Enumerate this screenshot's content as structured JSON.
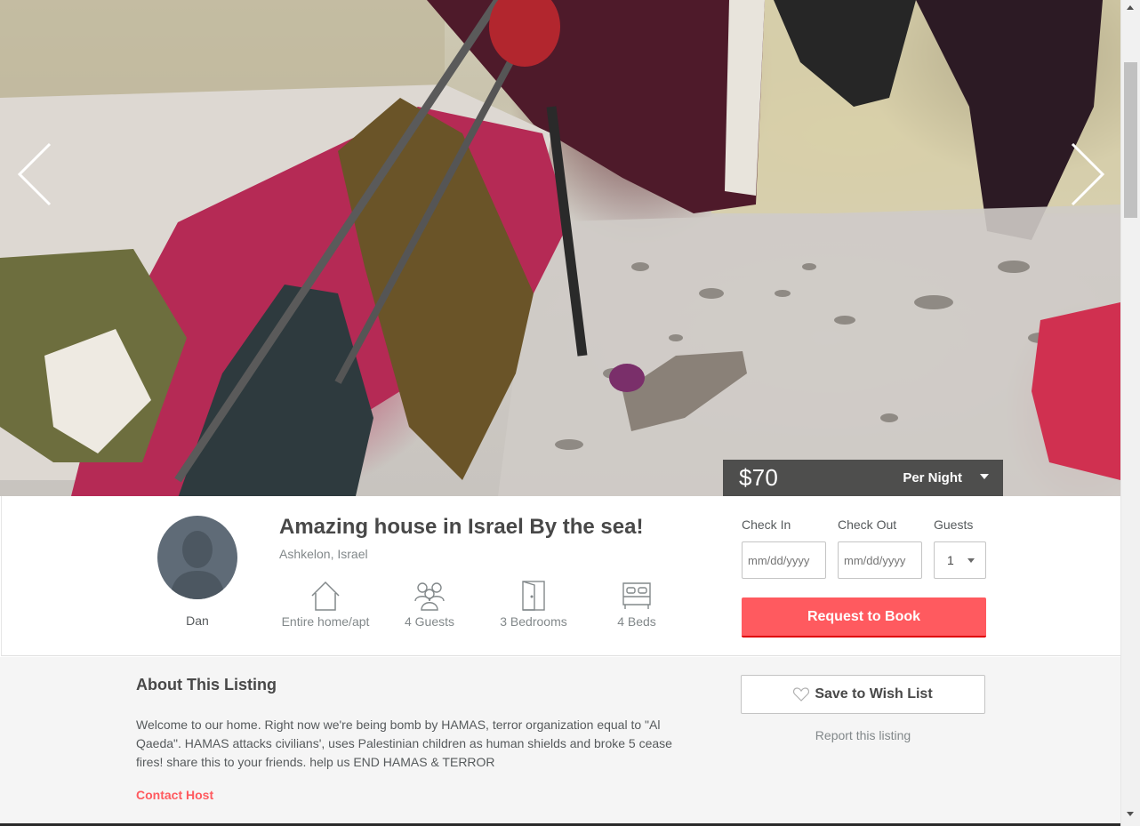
{
  "gallery": {
    "prev_label": "Previous photo",
    "next_label": "Next photo"
  },
  "price": {
    "amount": "$70",
    "period": "Per Night"
  },
  "host": {
    "name": "Dan"
  },
  "listing": {
    "title": "Amazing house in Israel By the sea!",
    "location": "Ashkelon, Israel",
    "amenities": [
      {
        "icon": "house-icon",
        "label": "Entire home/apt"
      },
      {
        "icon": "guests-icon",
        "label": "4 Guests"
      },
      {
        "icon": "door-icon",
        "label": "3 Bedrooms"
      },
      {
        "icon": "bed-icon",
        "label": "4 Beds"
      }
    ]
  },
  "booking": {
    "check_in_label": "Check In",
    "check_out_label": "Check Out",
    "guests_label": "Guests",
    "date_placeholder": "mm/dd/yyyy",
    "guests_value": "1",
    "request_button": "Request to Book"
  },
  "about": {
    "heading": "About This Listing",
    "description": "Welcome to our home. Right now we're being bomb by HAMAS, terror organization equal to \"Al Qaeda\". HAMAS attacks civilians', uses Palestinian children as human shields and broke 5 cease fires! share this to your friends. help us END HAMAS & TERROR",
    "contact_host": "Contact Host"
  },
  "actions": {
    "wish_list": "Save to Wish List",
    "report": "Report this listing"
  },
  "colors": {
    "accent": "#ff5a5f",
    "text": "#484848",
    "muted": "#82888a",
    "price_bar": "#3c3c3c"
  }
}
